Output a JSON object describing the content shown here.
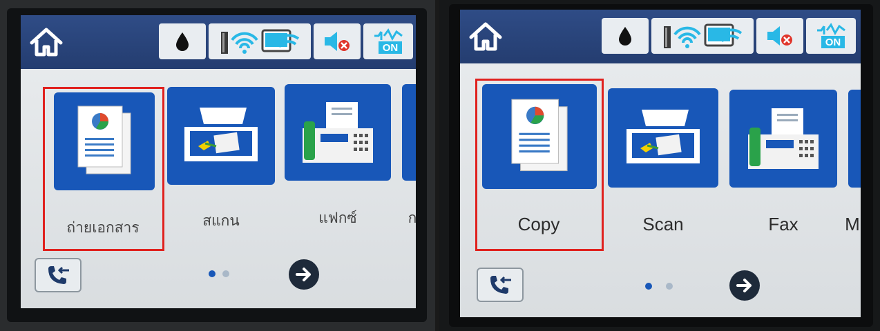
{
  "left_panel": {
    "tiles": [
      {
        "label": "ถ่ายเอกสาร",
        "icon": "copy-document-icon"
      },
      {
        "label": "สแกน",
        "icon": "scanner-icon"
      },
      {
        "label": "แฟกซ์",
        "icon": "fax-icon"
      },
      {
        "label": "ก",
        "icon": "next-tile-icon"
      }
    ]
  },
  "right_panel": {
    "tiles": [
      {
        "label": "Copy",
        "icon": "copy-document-icon"
      },
      {
        "label": "Scan",
        "icon": "scanner-icon"
      },
      {
        "label": "Fax",
        "icon": "fax-icon"
      },
      {
        "label": "M",
        "icon": "next-tile-icon"
      }
    ]
  },
  "status_bar": {
    "icons": [
      "ink-drop-icon",
      "wifi-router-icon",
      "wifi-direct-icon",
      "sound-muted-icon",
      "eco-mode-icon"
    ],
    "eco_label": "ON"
  },
  "pagination": {
    "pages": 2,
    "current": 1
  },
  "colors": {
    "tile": "#1857b8",
    "topbar": "#2a4578",
    "highlight": "#e0211e",
    "screen": "#dfe3e6"
  }
}
